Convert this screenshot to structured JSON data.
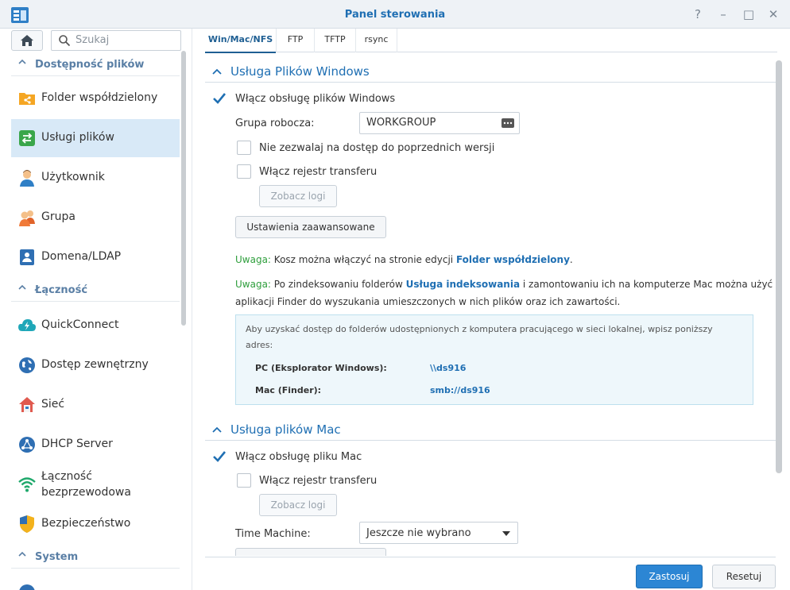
{
  "window": {
    "title": "Panel sterowania",
    "buttons": {
      "help": "?",
      "minimize": "–",
      "maximize": "□",
      "close": "✕"
    }
  },
  "sidebar": {
    "search_placeholder": "Szukaj",
    "sections": [
      {
        "label": "Dostępność plików",
        "items": [
          {
            "label": "Folder współdzielony",
            "icon": "shared-folder-icon"
          },
          {
            "label": "Usługi plików",
            "icon": "file-services-icon",
            "active": true
          },
          {
            "label": "Użytkownik",
            "icon": "user-icon"
          },
          {
            "label": "Grupa",
            "icon": "group-icon"
          },
          {
            "label": "Domena/LDAP",
            "icon": "domain-ldap-icon"
          }
        ]
      },
      {
        "label": "Łączność",
        "items": [
          {
            "label": "QuickConnect",
            "icon": "quickconnect-icon"
          },
          {
            "label": "Dostęp zewnętrzny",
            "icon": "external-access-icon"
          },
          {
            "label": "Sieć",
            "icon": "network-icon"
          },
          {
            "label": "DHCP Server",
            "icon": "dhcp-server-icon"
          },
          {
            "label_line1": "Łączność",
            "label_line2": "bezprzewodowa",
            "icon": "wireless-icon"
          },
          {
            "label": "Bezpieczeństwo",
            "icon": "security-icon"
          }
        ]
      },
      {
        "label": "System",
        "items": []
      }
    ]
  },
  "tabs": [
    "Win/Mac/NFS",
    "FTP",
    "TFTP",
    "rsync"
  ],
  "active_tab": 0,
  "windows_section": {
    "title": "Usługa Plików Windows",
    "enable_label": "Włącz obsługę plików Windows",
    "enable_checked": true,
    "workgroup_label": "Grupa robocza:",
    "workgroup_value": "WORKGROUP",
    "prev_versions_label": "Nie zezwalaj na dostęp do poprzednich wersji",
    "prev_versions_checked": false,
    "transfer_log_label": "Włącz rejestr transferu",
    "transfer_log_checked": false,
    "view_logs": "Zobacz logi",
    "advanced": "Ustawienia zaawansowane",
    "note1_prefix": "Uwaga:",
    "note1_text": "Kosz można włączyć na stronie edycji",
    "note1_link": "Folder współdzielony",
    "note1_end": ".",
    "note2_prefix": "Uwaga:",
    "note2_text_a": "Po zindeksowaniu folderów",
    "note2_link": "Usługa indeksowania",
    "note2_text_b": "i zamontowaniu ich na komputerze Mac można użyć",
    "note2_text_c": "aplikacji Finder do wyszukania umieszczonych w nich plików oraz ich zawartości.",
    "info_text": "Aby uzyskać dostęp do folderów udostępnionych z komputera pracującego w sieci lokalnej, wpisz poniższy adres:",
    "info_pc_label": "PC (Eksplorator Windows):",
    "info_pc_value": "\\\\ds916",
    "info_mac_label": "Mac (Finder):",
    "info_mac_value": "smb://ds916"
  },
  "mac_section": {
    "title": "Usługa plików Mac",
    "enable_label": "Włącz obsługę pliku Mac",
    "enable_checked": true,
    "transfer_log_label": "Włącz rejestr transferu",
    "transfer_log_checked": false,
    "view_logs": "Zobacz logi",
    "time_machine_label": "Time Machine:",
    "time_machine_value": "Jeszcze nie wybrano"
  },
  "footer": {
    "apply": "Zastosuj",
    "reset": "Resetuj"
  },
  "colors": {
    "accent": "#1f6fb3",
    "active_bg": "#d8e9f7",
    "note_green": "#2e9e3c",
    "primary_btn": "#2c86d4"
  }
}
